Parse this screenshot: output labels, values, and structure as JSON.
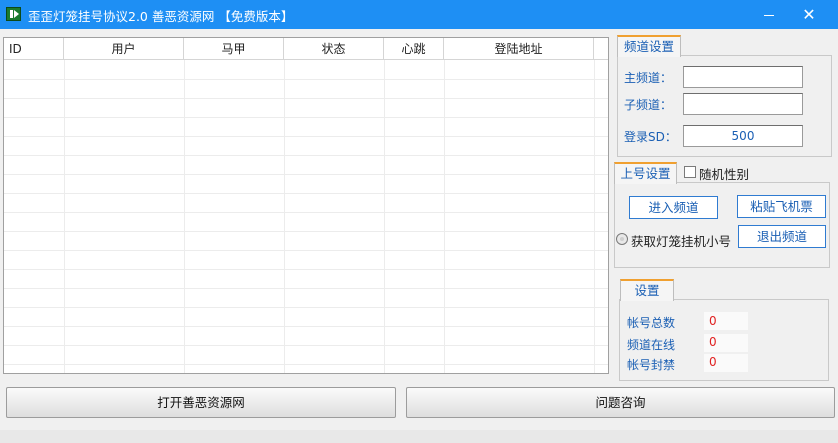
{
  "window": {
    "title": "歪歪灯笼挂号协议2.0   善恶资源网    【免费版本】",
    "minimize_icon": "minimize-icon",
    "close_icon": "close-icon",
    "close_glyph": "✕",
    "titlebar_color": "#1e8ff4"
  },
  "grid": {
    "columns": [
      "ID",
      "用户",
      "马甲",
      "状态",
      "心跳",
      "登陆地址"
    ],
    "rows": []
  },
  "channel_settings": {
    "tab_label": "频道设置",
    "main_channel_label": "主频道：",
    "main_channel_value": "",
    "sub_channel_label": "子频道：",
    "sub_channel_value": "",
    "login_sd_label": "登录SD：",
    "login_sd_value": "500"
  },
  "account_settings": {
    "tab_label": "上号设置",
    "random_gender_label": "随机性别",
    "random_gender_checked": false,
    "enter_channel_button": "进入频道",
    "paste_ticket_button": "粘贴飞机票",
    "get_small_account_label": "获取灯笼挂机小号",
    "get_small_account_selected": false,
    "exit_channel_button": "退出频道"
  },
  "settings": {
    "tab_label": "设置",
    "total_accounts_label": "帐号总数",
    "total_accounts_value": "0",
    "online_label": "频道在线",
    "online_value": "0",
    "banned_label": "帐号封禁",
    "banned_value": "0",
    "value_color": "#e02020"
  },
  "bottom": {
    "open_site_button": "打开善恶资源网",
    "help_button": "问题咨询"
  }
}
